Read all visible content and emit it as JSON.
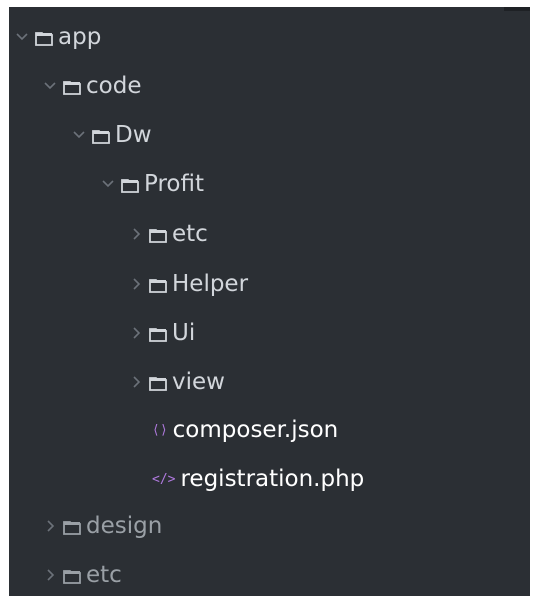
{
  "tree": {
    "items": [
      {
        "label": "app",
        "type": "folder",
        "state": "expanded"
      },
      {
        "label": "code",
        "type": "folder",
        "state": "expanded"
      },
      {
        "label": "Dw",
        "type": "folder",
        "state": "expanded"
      },
      {
        "label": "Profit",
        "type": "folder",
        "state": "expanded"
      },
      {
        "label": "etc",
        "type": "folder",
        "state": "collapsed"
      },
      {
        "label": "Helper",
        "type": "folder",
        "state": "collapsed"
      },
      {
        "label": "Ui",
        "type": "folder",
        "state": "collapsed"
      },
      {
        "label": "view",
        "type": "folder",
        "state": "collapsed"
      },
      {
        "label": "composer.json",
        "type": "file",
        "icon_glyph": "⟨⟩"
      },
      {
        "label": "registration.php",
        "type": "file",
        "icon_glyph": "</>"
      },
      {
        "label": "design",
        "type": "folder",
        "state": "collapsed"
      },
      {
        "label": "etc",
        "type": "folder",
        "state": "collapsed"
      }
    ]
  },
  "colors": {
    "panel_bg": "#2b2f34",
    "folder_text": "#d2d6db",
    "file_text": "#ffffff",
    "file_icon": "#b07adf",
    "chevron": "#6c727a"
  }
}
